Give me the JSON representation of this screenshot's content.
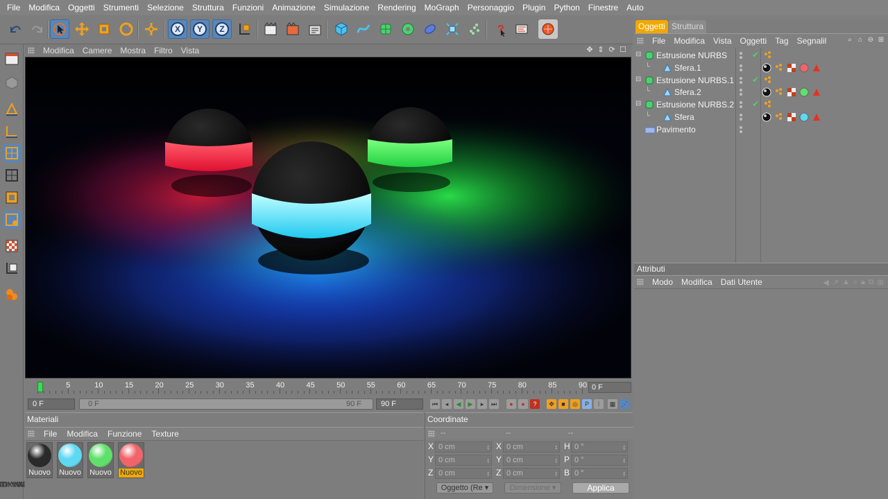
{
  "menubar": [
    "File",
    "Modifica",
    "Oggetti",
    "Strumenti",
    "Selezione",
    "Struttura",
    "Funzioni",
    "Animazione",
    "Simulazione",
    "Rendering",
    "MoGraph",
    "Personaggio",
    "Plugin",
    "Python",
    "Finestre",
    "Auto"
  ],
  "viewport": {
    "menu": [
      "Modifica",
      "Camere",
      "Mostra",
      "Filtro",
      "Vista"
    ]
  },
  "timeline": {
    "ticks": [
      "0",
      "5",
      "10",
      "15",
      "20",
      "25",
      "30",
      "35",
      "40",
      "45",
      "50",
      "55",
      "60",
      "65",
      "70",
      "75",
      "80",
      "85",
      "90"
    ],
    "current_frame": "0 F",
    "start_field": "0 F",
    "range_start": "0 F",
    "range_end": "90 F",
    "end_field": "90 F"
  },
  "materials": {
    "title": "Materiali",
    "menu": [
      "File",
      "Modifica",
      "Funzione",
      "Texture"
    ],
    "items": [
      {
        "label": "Nuovo",
        "color": "#2a2a2a",
        "selected": false
      },
      {
        "label": "Nuovo",
        "color": "#5fd8f2",
        "selected": false
      },
      {
        "label": "Nuovo",
        "color": "#5fe06a",
        "selected": false
      },
      {
        "label": "Nuovo",
        "color": "#f0646a",
        "selected": true
      }
    ]
  },
  "coordinates": {
    "title": "Coordinate",
    "header": [
      "--",
      "--",
      "--"
    ],
    "rows": [
      {
        "a1": "X",
        "v1": "0 cm",
        "a2": "X",
        "v2": "0 cm",
        "a3": "H",
        "v3": "0 °"
      },
      {
        "a1": "Y",
        "v1": "0 cm",
        "a2": "Y",
        "v2": "0 cm",
        "a3": "P",
        "v3": "0 °"
      },
      {
        "a1": "Z",
        "v1": "0 cm",
        "a2": "Z",
        "v2": "0 cm",
        "a3": "B",
        "v3": "0 °"
      }
    ],
    "mode_dropdown": "Oggetto (Re",
    "size_dropdown": "Dimensione",
    "apply": "Applica"
  },
  "objects": {
    "tabs": [
      "Oggetti",
      "Struttura"
    ],
    "menu": [
      "File",
      "Modifica",
      "Vista",
      "Oggetti",
      "Tag",
      "Segnalil"
    ],
    "tree": [
      {
        "name": "Estrusione NURBS",
        "level": 0,
        "icon": "nurbs-icon",
        "check": true
      },
      {
        "name": "Sfera.1",
        "level": 1,
        "icon": "sphere-icon",
        "material": "#f0646a"
      },
      {
        "name": "Estrusione NURBS.1",
        "level": 0,
        "icon": "nurbs-icon",
        "check": true
      },
      {
        "name": "Sfera.2",
        "level": 1,
        "icon": "sphere-icon",
        "material": "#5fe06a"
      },
      {
        "name": "Estrusione NURBS.2",
        "level": 0,
        "icon": "nurbs-icon",
        "check": true
      },
      {
        "name": "Sfera",
        "level": 1,
        "icon": "sphere-icon",
        "material": "#5fd8f2"
      },
      {
        "name": "Pavimento",
        "level": 0,
        "icon": "floor-icon"
      }
    ]
  },
  "attributes": {
    "title": "Attributi",
    "menu": [
      "Modo",
      "Modifica",
      "Dati Utente"
    ]
  },
  "logo": {
    "line1": "MAXON",
    "line2": "CINEMA 4D"
  }
}
